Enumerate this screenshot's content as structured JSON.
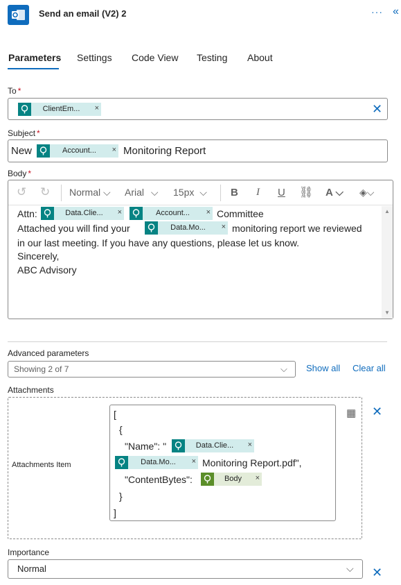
{
  "header": {
    "title": "Send an email (V2) 2",
    "more_icon": "ellipsis-icon",
    "collapse_icon": "double-chevron-left-icon",
    "app_icon": "outlook-icon",
    "colors": {
      "accent": "#0f6cbd",
      "token_teal": "#068383",
      "token_bg": "#d2ecec",
      "token_green": "#5b8e29",
      "required": "#c50f1f"
    }
  },
  "tabs": [
    {
      "label": "Parameters",
      "active": true
    },
    {
      "label": "Settings",
      "active": false
    },
    {
      "label": "Code View",
      "active": false
    },
    {
      "label": "Testing",
      "active": false
    },
    {
      "label": "About",
      "active": false
    }
  ],
  "to": {
    "label": "To",
    "required_mark": "*",
    "token": "ClientEm...",
    "remove": "×"
  },
  "subject": {
    "label": "Subject",
    "required_mark": "*",
    "prefix": "New",
    "token": "Account...",
    "suffix": "Monitoring Report"
  },
  "body": {
    "label": "Body",
    "required_mark": "*",
    "toolbar": {
      "font_style": "Normal",
      "font_family": "Arial",
      "font_size": "15px",
      "bold": "B",
      "italic": "I",
      "underline": "U",
      "font_color": "A"
    },
    "line1": {
      "prefix": "Attn:",
      "token1": "Data.Clie...",
      "token2": "Account...",
      "suffix": "Committee"
    },
    "line2": {
      "prefix": "Attached you will find your",
      "token": "Data.Mo...",
      "suffix": "monitoring report we reviewed"
    },
    "line3": "in our last meeting. If you have any questions, please let us know.",
    "line4": "Sincerely,",
    "line5": "ABC Advisory"
  },
  "advanced": {
    "label": "Advanced parameters",
    "select_value": "Showing 2 of 7",
    "show_all": "Show all",
    "clear_all": "Clear all"
  },
  "attachments": {
    "label": "Attachments",
    "item_label": "Attachments Item",
    "json": {
      "open_bracket": "[",
      "open_brace": "{",
      "name_key": "\"Name\": \"",
      "token1": "Data.Clie...",
      "token2": "Data.Mo...",
      "name_suffix": "Monitoring Report.pdf\",",
      "content_key": "\"ContentBytes\":",
      "body_token": "Body",
      "close_brace": "}",
      "close_bracket": "]"
    }
  },
  "importance": {
    "label": "Importance",
    "value": "Normal"
  }
}
